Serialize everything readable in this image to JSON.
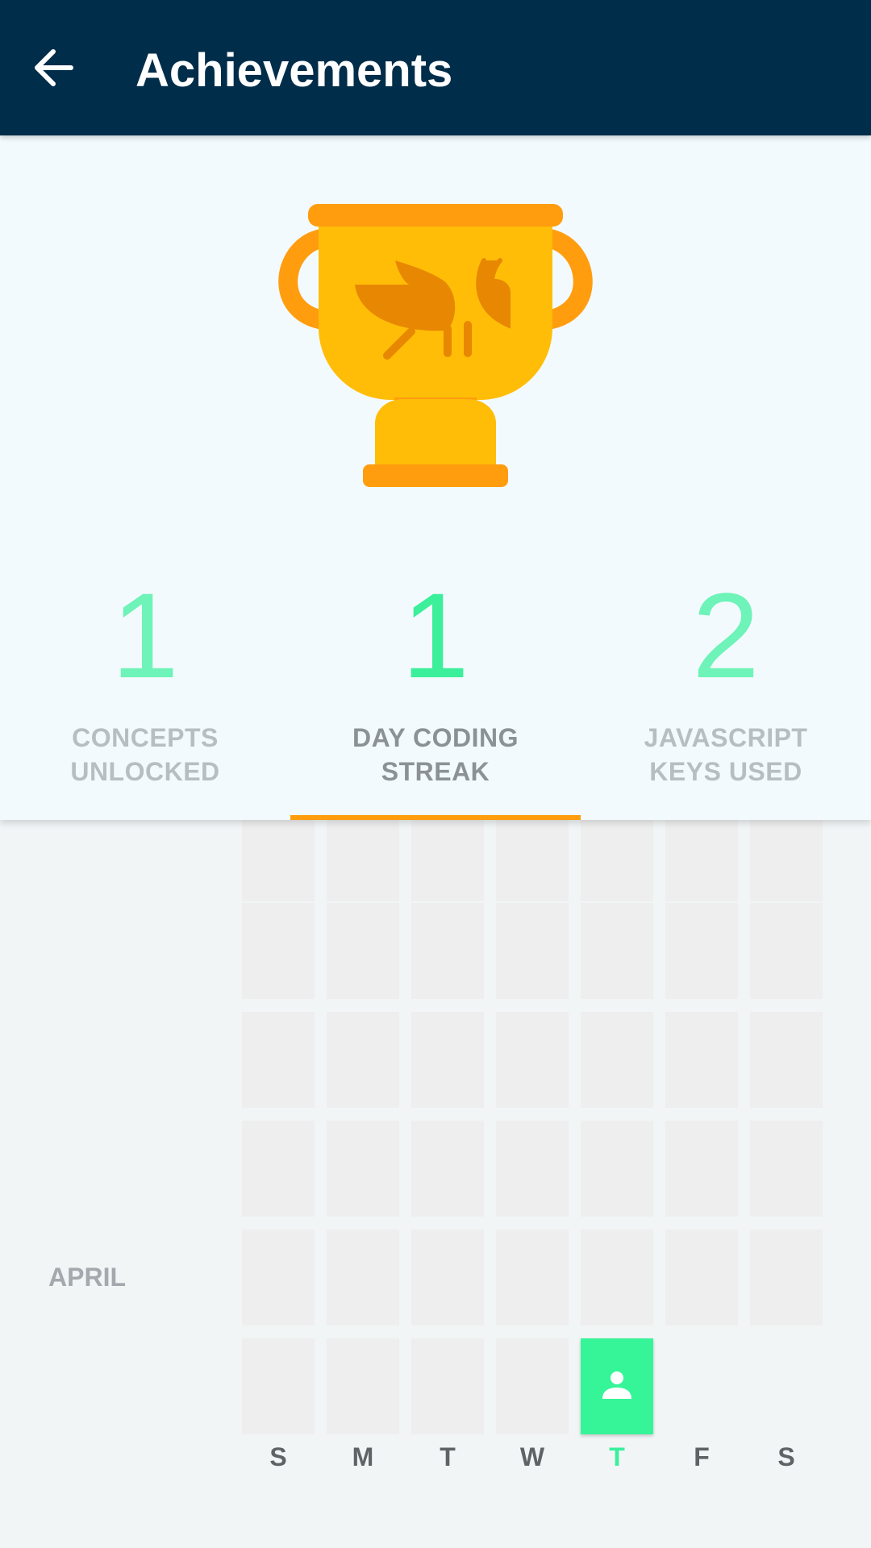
{
  "appbar": {
    "title": "Achievements"
  },
  "colors": {
    "appbar_bg": "#002d4a",
    "accent_green": "#36f598",
    "stat_green_light": "#6ef3b8",
    "indicator_orange": "#ff9d0f",
    "trophy_gold": "#ffbd07",
    "trophy_orange": "#ff9d0f"
  },
  "hero": {
    "trophy_icon": "trophy-with-grasshopper-icon"
  },
  "stats": [
    {
      "value": "1",
      "label": "CONCEPTS UNLOCKED",
      "active": false
    },
    {
      "value": "1",
      "label": "DAY CODING STREAK",
      "active": true
    },
    {
      "value": "2",
      "label": "JAVASCRIPT KEYS USED",
      "active": false
    }
  ],
  "calendar": {
    "month_label": "APRIL",
    "weekdays": [
      "S",
      "M",
      "T",
      "W",
      "T",
      "F",
      "S"
    ],
    "current_weekday_index": 4,
    "today_icon": "person-icon"
  }
}
